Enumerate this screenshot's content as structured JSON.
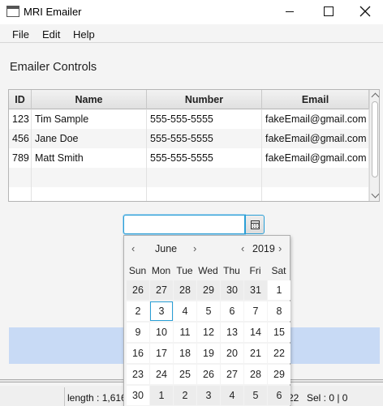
{
  "window": {
    "title": "MRI Emailer",
    "app_icon": "window-app-icon"
  },
  "menu": [
    "File",
    "Edit",
    "Help"
  ],
  "section_label": "Emailer Controls",
  "table": {
    "columns": [
      "ID",
      "Name",
      "Number",
      "Email"
    ],
    "rows": [
      [
        "123",
        "Tim Sample",
        "555-555-5555",
        "fakeEmail@gmail.com"
      ],
      [
        "456",
        "Jane Doe",
        "555-555-5555",
        "fakeEmail@gmail.com"
      ],
      [
        "789",
        "Matt Smith",
        "555-555-5555",
        "fakeEmail@gmail.com"
      ]
    ]
  },
  "date_picker": {
    "value": "",
    "icon": "calendar-icon"
  },
  "calendar": {
    "month": "June",
    "year": "2019",
    "prev": "‹",
    "next": "›",
    "weekdays": [
      "Sun",
      "Mon",
      "Tue",
      "Wed",
      "Thu",
      "Fri",
      "Sat"
    ],
    "today": "3",
    "weeks": [
      [
        "26",
        "27",
        "28",
        "29",
        "30",
        "31",
        "1"
      ],
      [
        "2",
        "3",
        "4",
        "5",
        "6",
        "7",
        "8"
      ],
      [
        "9",
        "10",
        "11",
        "12",
        "13",
        "14",
        "15"
      ],
      [
        "16",
        "17",
        "18",
        "19",
        "20",
        "21",
        "22"
      ],
      [
        "23",
        "24",
        "25",
        "26",
        "27",
        "28",
        "29"
      ],
      [
        "30",
        "1",
        "2",
        "3",
        "4",
        "5",
        "6"
      ]
    ],
    "muted_cells": [
      [
        0,
        0
      ],
      [
        0,
        1
      ],
      [
        0,
        2
      ],
      [
        0,
        3
      ],
      [
        0,
        4
      ],
      [
        0,
        5
      ],
      [
        5,
        1
      ],
      [
        5,
        2
      ],
      [
        5,
        3
      ],
      [
        5,
        4
      ],
      [
        5,
        5
      ],
      [
        5,
        6
      ]
    ]
  },
  "status": {
    "length": "length : 1,616",
    "fragment": "22",
    "sel": "Sel : 0 | 0"
  },
  "colors": {
    "accent": "#2a9fd6",
    "selection_panel": "#c8daf5"
  }
}
